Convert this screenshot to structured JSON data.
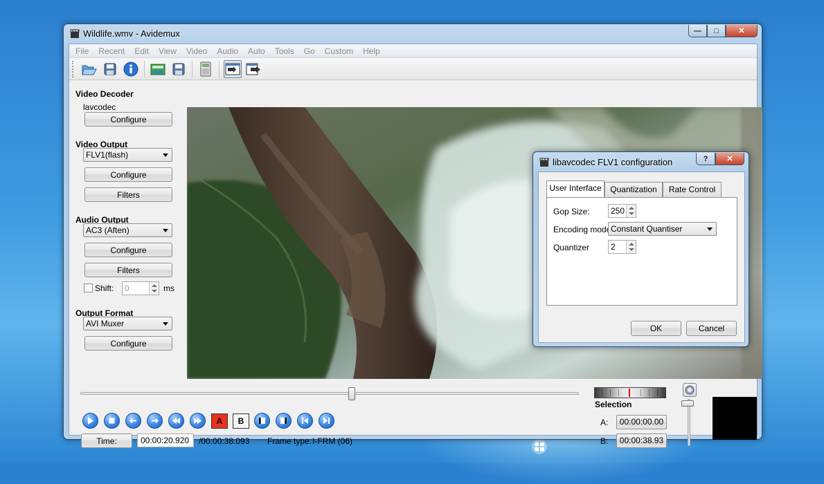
{
  "window": {
    "title": "Wildlife.wmv - Avidemux",
    "caption_min": "—",
    "caption_max": "□",
    "caption_close": "✕"
  },
  "menu": [
    "File",
    "Recent",
    "Edit",
    "View",
    "Video",
    "Audio",
    "Auto",
    "Tools",
    "Go",
    "Custom",
    "Help"
  ],
  "toolbar_icons": [
    "open-icon",
    "save-icon",
    "info-icon",
    "open-image-icon",
    "save-image-icon",
    "calculator-icon",
    "input-mode-icon",
    "output-mode-icon"
  ],
  "video_decoder": {
    "title": "Video Decoder",
    "codec": "lavcodec",
    "configure": "Configure"
  },
  "video_output": {
    "title": "Video Output",
    "selected": "FLV1(flash)",
    "configure": "Configure",
    "filters": "Filters"
  },
  "audio_output": {
    "title": "Audio Output",
    "selected": "AC3 (Aften)",
    "configure": "Configure",
    "filters": "Filters",
    "shift_label": "Shift:",
    "shift_value": "0",
    "shift_unit": "ms"
  },
  "output_format": {
    "title": "Output Format",
    "selected": "AVI Muxer",
    "configure": "Configure"
  },
  "transport": {
    "marker_a": "A",
    "marker_b": "B",
    "buttons": [
      "play-icon",
      "stop-icon",
      "previous-frame-icon",
      "next-frame-icon",
      "previous-keyframe-icon",
      "next-keyframe-icon",
      "set-marker-a",
      "set-marker-b",
      "goto-marker-a-icon",
      "goto-marker-b-icon",
      "previous-black-frame-icon",
      "next-black-frame-icon"
    ]
  },
  "status": {
    "time_button": "Time:",
    "current_time": "00:00:20.920",
    "total_time": "/00:00:38.093",
    "frame_type_label": "Frame type:",
    "frame_type_value": "I-FRM (06)"
  },
  "selection": {
    "title": "Selection",
    "a_label": "A:",
    "a_value": "00:00:00.00",
    "b_label": "B:",
    "b_value": "00:00:38.93"
  },
  "dialog": {
    "title": "libavcodec FLV1 configuration",
    "help": "?",
    "close": "✕",
    "tabs": [
      "User Interface",
      "Quantization",
      "Rate Control"
    ],
    "active_tab": "User Interface",
    "gop_label": "Gop Size:",
    "gop_value": "250",
    "encoding_label": "Encoding mode",
    "encoding_value": "Constant Quantiser",
    "quantizer_label": "Quantizer",
    "quantizer_value": "2",
    "ok": "OK",
    "cancel": "Cancel"
  },
  "colors": {
    "window_frame": "#a9c8e6",
    "desktop": "#3e9be0",
    "transport_blue": "#3c88e4",
    "marker_red": "#e8321f"
  }
}
